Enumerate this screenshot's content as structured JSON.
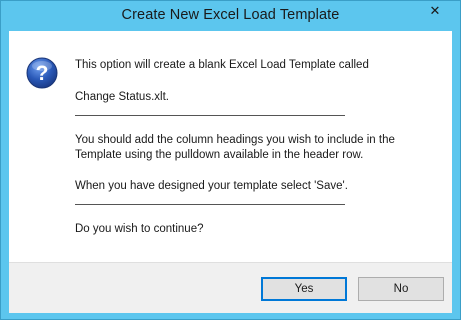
{
  "window": {
    "title": "Create New Excel Load Template",
    "close_glyph": "✕"
  },
  "message": {
    "icon": "question-icon",
    "line1": "This option will create a blank Excel Load Template called",
    "line2": "Change Status.xlt.",
    "line3": "You should add the column headings you wish to include in the",
    "line4": "Template using the pulldown available in the header row.",
    "line5": "When you have designed your template select 'Save'.",
    "line6": "Do you wish to continue?"
  },
  "buttons": {
    "yes": "Yes",
    "no": "No"
  },
  "colors": {
    "frame": "#5cc6ee",
    "footer": "#f0f0f0",
    "default_button_border": "#0078d7",
    "icon": "#2a59b8"
  }
}
